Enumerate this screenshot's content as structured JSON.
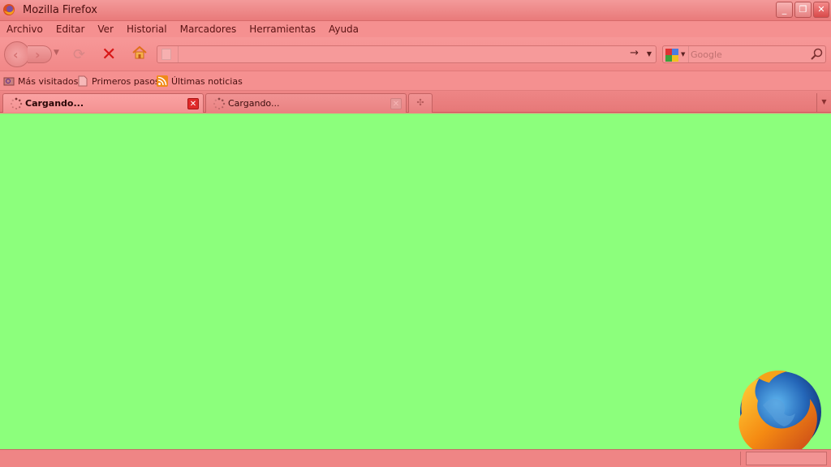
{
  "window": {
    "title": "Mozilla Firefox",
    "minimize": "_",
    "restore": "❐",
    "close": "✕"
  },
  "menu": [
    "Archivo",
    "Editar",
    "Ver",
    "Historial",
    "Marcadores",
    "Herramientas",
    "Ayuda"
  ],
  "nav": {
    "url_value": "",
    "search_placeholder": "Google"
  },
  "bookmarks": [
    {
      "label": "Más visitados",
      "icon": "folder-search-icon"
    },
    {
      "label": "Primeros pasos",
      "icon": "page-icon"
    },
    {
      "label": "Últimas noticias",
      "icon": "rss-feed-icon"
    }
  ],
  "tabs": [
    {
      "label": "Cargando...",
      "active": true
    },
    {
      "label": "Cargando...",
      "active": false
    }
  ],
  "colors": {
    "chrome": "#f08080",
    "content": "#8cff7c",
    "stop": "#d81616"
  }
}
